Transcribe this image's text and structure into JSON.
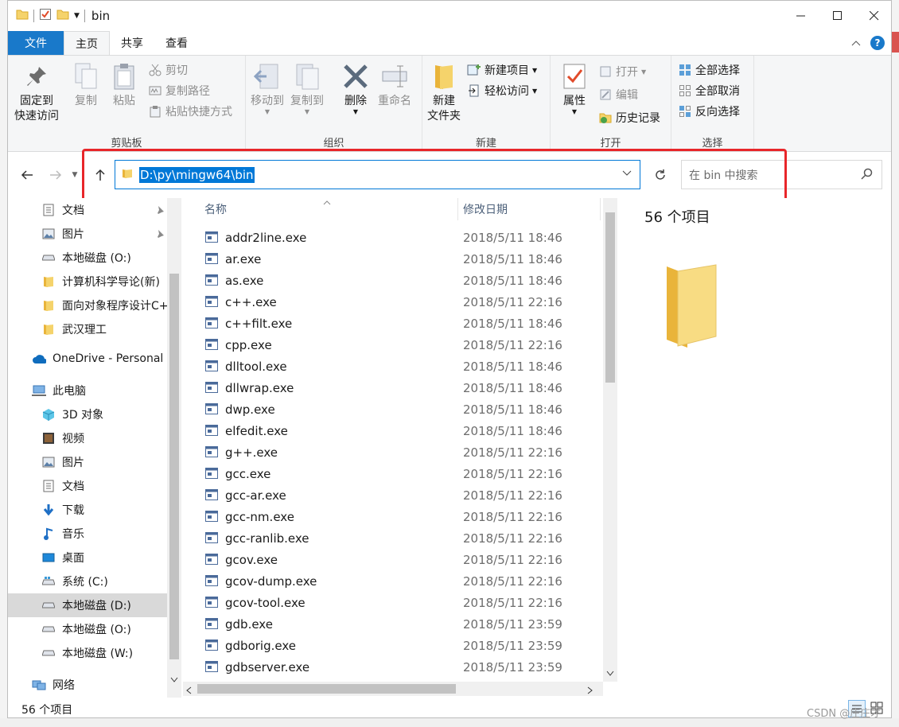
{
  "window": {
    "title": "bin"
  },
  "tabs": [
    {
      "label": "文件"
    },
    {
      "label": "主页"
    },
    {
      "label": "共享"
    },
    {
      "label": "查看"
    }
  ],
  "ribbon": {
    "clipboard": {
      "label": "剪贴板",
      "pin": "固定到\n快速访问",
      "pin_l1": "固定到",
      "pin_l2": "快速访问",
      "copy": "复制",
      "paste": "粘贴",
      "cut": "剪切",
      "copy_path": "复制路径",
      "paste_shortcut": "粘贴快捷方式"
    },
    "organize": {
      "label": "组织",
      "move_to": "移动到",
      "copy_to": "复制到",
      "delete": "删除",
      "rename": "重命名"
    },
    "new": {
      "label": "新建",
      "new_folder_l1": "新建",
      "new_folder_l2": "文件夹",
      "new_item": "新建项目",
      "easy_access": "轻松访问"
    },
    "open": {
      "label": "打开",
      "properties": "属性",
      "open": "打开",
      "edit": "编辑",
      "history": "历史记录"
    },
    "select": {
      "label": "选择",
      "select_all": "全部选择",
      "select_none": "全部取消",
      "invert": "反向选择"
    }
  },
  "address": {
    "path": "D:\\py\\mingw64\\bin"
  },
  "search": {
    "placeholder": "在 bin 中搜索"
  },
  "nav": {
    "items": [
      {
        "label": "文档",
        "icon": "document-icon",
        "pinned": true
      },
      {
        "label": "图片",
        "icon": "picture-icon",
        "pinned": true
      },
      {
        "label": "本地磁盘 (O:)",
        "icon": "drive-icon"
      },
      {
        "label": "计算机科学导论(新)",
        "icon": "folder-icon"
      },
      {
        "label": "面向对象程序设计C++",
        "icon": "folder-icon"
      },
      {
        "label": "武汉理工",
        "icon": "folder-icon"
      },
      {
        "label": "OneDrive - Personal",
        "icon": "cloud-icon"
      },
      {
        "label": "此电脑",
        "icon": "computer-icon"
      },
      {
        "label": "3D 对象",
        "icon": "cube-icon"
      },
      {
        "label": "视频",
        "icon": "video-icon"
      },
      {
        "label": "图片",
        "icon": "picture-icon"
      },
      {
        "label": "文档",
        "icon": "document-icon"
      },
      {
        "label": "下载",
        "icon": "download-icon"
      },
      {
        "label": "音乐",
        "icon": "music-icon"
      },
      {
        "label": "桌面",
        "icon": "desktop-icon"
      },
      {
        "label": "系统 (C:)",
        "icon": "drive-icon"
      },
      {
        "label": "本地磁盘 (D:)",
        "icon": "drive-icon"
      },
      {
        "label": "本地磁盘 (O:)",
        "icon": "drive-icon"
      },
      {
        "label": "本地磁盘 (W:)",
        "icon": "drive-icon"
      },
      {
        "label": "网络",
        "icon": "network-icon"
      }
    ]
  },
  "list": {
    "columns": {
      "name": "名称",
      "date": "修改日期"
    },
    "files": [
      {
        "name": "addr2line.exe",
        "date": "2018/5/11 18:46"
      },
      {
        "name": "ar.exe",
        "date": "2018/5/11 18:46"
      },
      {
        "name": "as.exe",
        "date": "2018/5/11 18:46"
      },
      {
        "name": "c++.exe",
        "date": "2018/5/11 22:16"
      },
      {
        "name": "c++filt.exe",
        "date": "2018/5/11 18:46"
      },
      {
        "name": "cpp.exe",
        "date": "2018/5/11 22:16"
      },
      {
        "name": "dlltool.exe",
        "date": "2018/5/11 18:46"
      },
      {
        "name": "dllwrap.exe",
        "date": "2018/5/11 18:46"
      },
      {
        "name": "dwp.exe",
        "date": "2018/5/11 18:46"
      },
      {
        "name": "elfedit.exe",
        "date": "2018/5/11 18:46"
      },
      {
        "name": "g++.exe",
        "date": "2018/5/11 22:16"
      },
      {
        "name": "gcc.exe",
        "date": "2018/5/11 22:16"
      },
      {
        "name": "gcc-ar.exe",
        "date": "2018/5/11 22:16"
      },
      {
        "name": "gcc-nm.exe",
        "date": "2018/5/11 22:16"
      },
      {
        "name": "gcc-ranlib.exe",
        "date": "2018/5/11 22:16"
      },
      {
        "name": "gcov.exe",
        "date": "2018/5/11 22:16"
      },
      {
        "name": "gcov-dump.exe",
        "date": "2018/5/11 22:16"
      },
      {
        "name": "gcov-tool.exe",
        "date": "2018/5/11 22:16"
      },
      {
        "name": "gdb.exe",
        "date": "2018/5/11 23:59"
      },
      {
        "name": "gdborig.exe",
        "date": "2018/5/11 23:59"
      },
      {
        "name": "gdbserver.exe",
        "date": "2018/5/11 23:59"
      }
    ]
  },
  "preview": {
    "count": "56 个项目"
  },
  "status": {
    "count": "56 个项目"
  },
  "watermark": "CSDN @庄庄才",
  "colors": {
    "accent": "#1979ca",
    "selection": "#0078d7",
    "highlight_box": "#e8262a",
    "folder": "#f5d36b"
  }
}
